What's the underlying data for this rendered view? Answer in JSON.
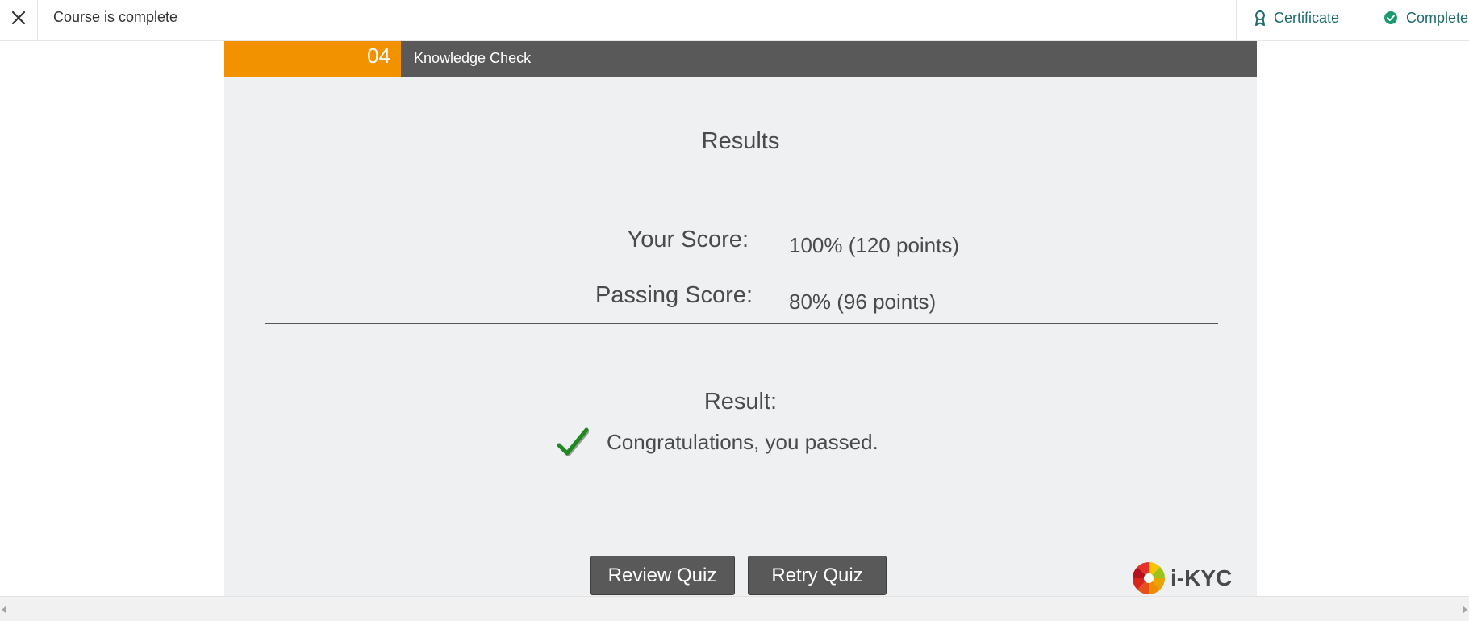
{
  "topbar": {
    "close_icon": "close-icon",
    "title": "Course is complete",
    "certificate_label": "Certificate",
    "certificate_icon": "award-ribbon-icon",
    "complete_label": "Complete",
    "complete_icon": "check-circle-icon",
    "complete_icon_color": "#1a9b6f"
  },
  "section": {
    "number": "04",
    "title": "Knowledge Check",
    "number_color": "#f39200",
    "title_bar_color": "#595959"
  },
  "results": {
    "title": "Results",
    "your_score_label": "Your Score:",
    "your_score_value": "100% (120 points)",
    "passing_score_label": "Passing Score:",
    "passing_score_value": "80% (96 points)",
    "result_label": "Result:",
    "result_message": "Congratulations, you passed.",
    "result_icon": "checkmark-icon",
    "result_icon_color": "#1e8a1e"
  },
  "buttons": {
    "review": "Review Quiz",
    "retry": "Retry Quiz"
  },
  "logo": {
    "text": "i-KYC",
    "icon": "ikyc-logo-icon"
  }
}
